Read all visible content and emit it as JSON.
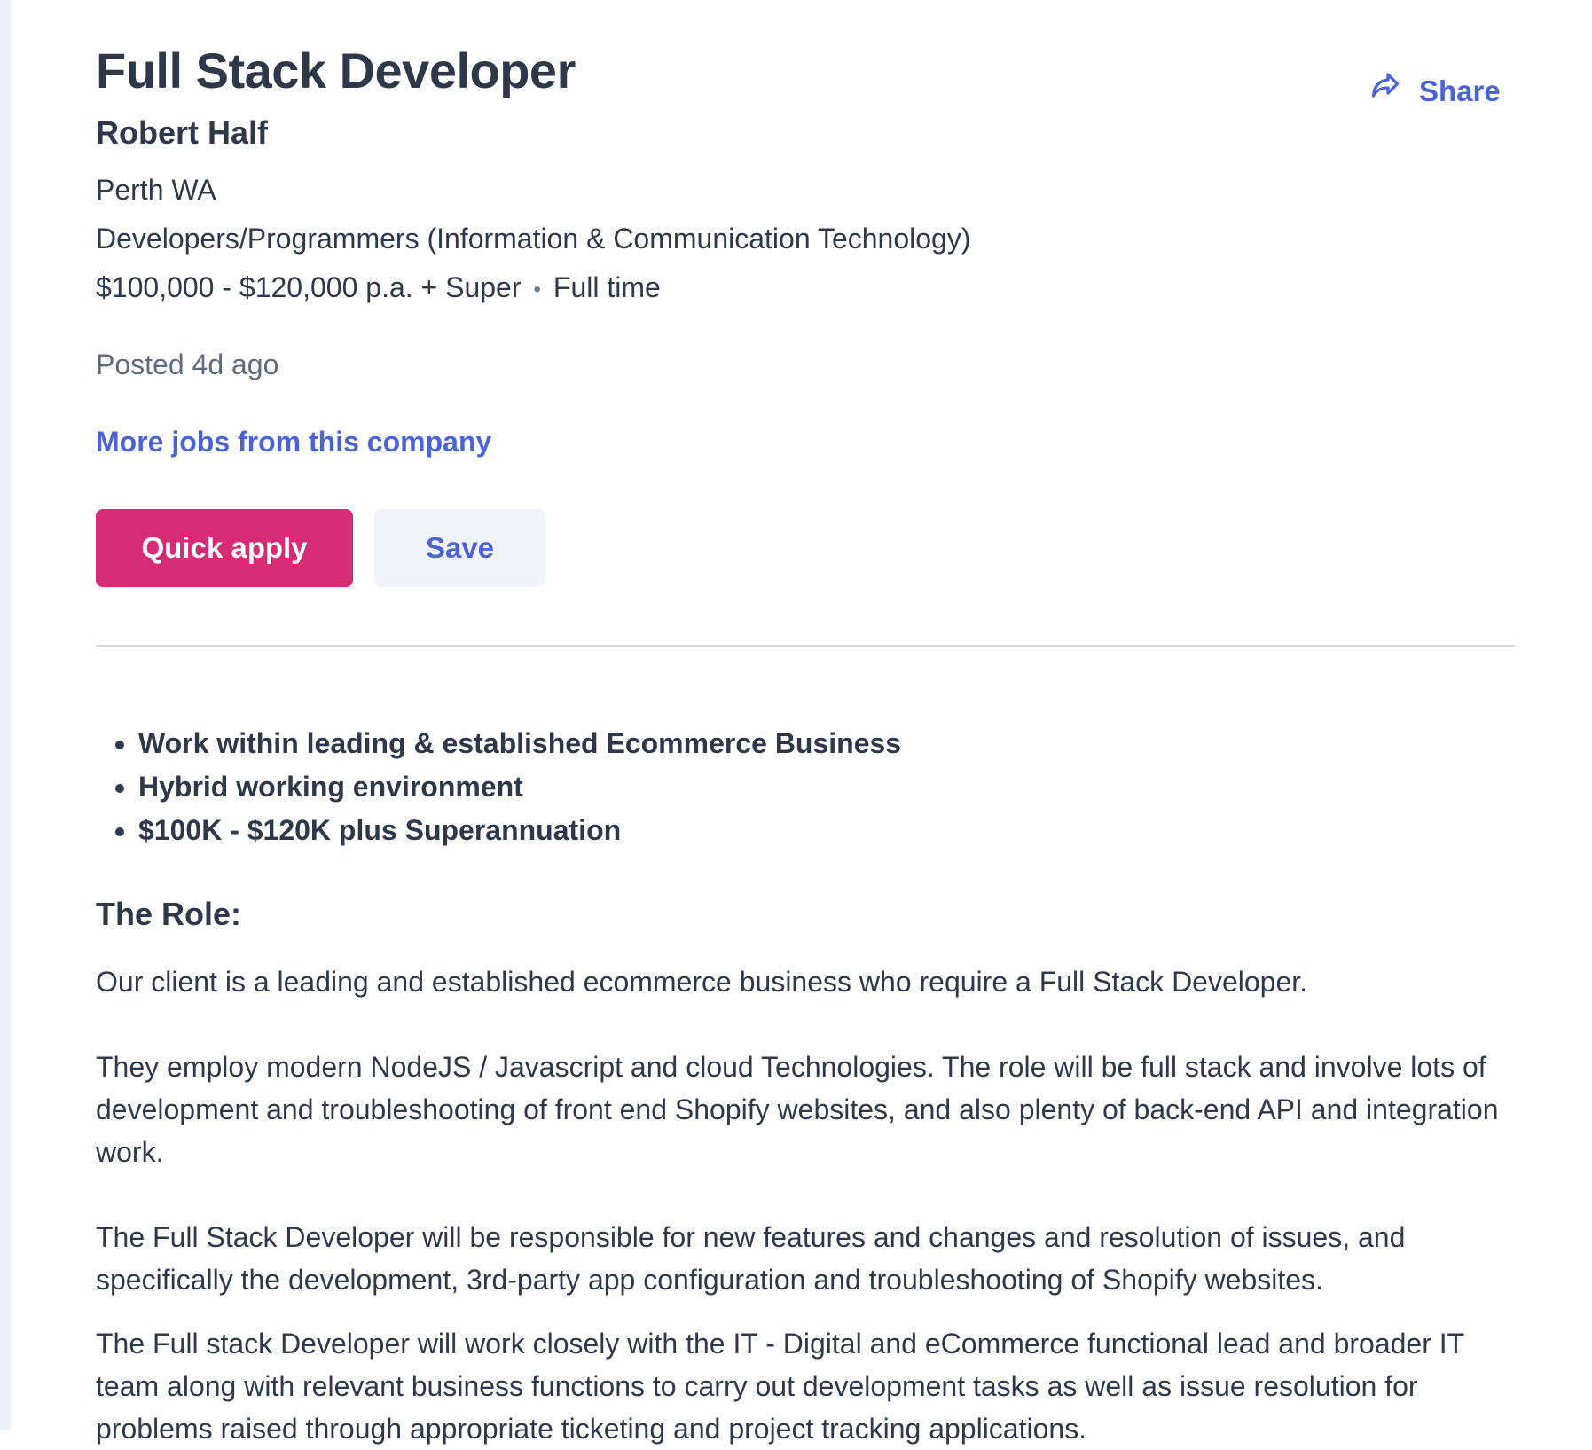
{
  "job": {
    "title": "Full Stack Developer",
    "company": "Robert Half",
    "location": "Perth WA",
    "category": "Developers/Programmers (Information & Communication Technology)",
    "salary": "$100,000 - $120,000 p.a. + Super",
    "separator": "•",
    "work_type": "Full time",
    "posted": "Posted 4d ago"
  },
  "links": {
    "more_jobs": "More jobs from this company",
    "share": "Share"
  },
  "actions": {
    "quick_apply": "Quick apply",
    "save": "Save"
  },
  "description": {
    "highlights": [
      "Work within leading & established Ecommerce Business",
      "Hybrid working environment",
      "$100K - $120K plus Superannuation"
    ],
    "role_heading": "The Role:",
    "paragraphs": [
      "Our client is a leading and established ecommerce business who require a Full Stack Developer.",
      "They employ modern NodeJS / Javascript and cloud Technologies. The role will be full stack and involve lots of development and troubleshooting of front end Shopify websites, and also plenty of back-end API and integration work.",
      "The Full Stack Developer will be responsible for new features and changes and resolution of issues, and specifically the development, 3rd-party app configuration and troubleshooting of Shopify websites.",
      "The Full stack Developer will work closely with the IT - Digital and eCommerce functional lead and broader IT team along with relevant business functions to carry out development tasks as well as issue resolution for problems raised through appropriate ticketing and project tracking applications."
    ]
  },
  "colors": {
    "primary_text": "#2e3849",
    "link": "#4c62d6",
    "apply_button": "#d52d73",
    "save_button_bg": "#f2f4fb",
    "divider": "#d3d6dd"
  },
  "icons": {
    "share": "share-arrow-icon"
  }
}
